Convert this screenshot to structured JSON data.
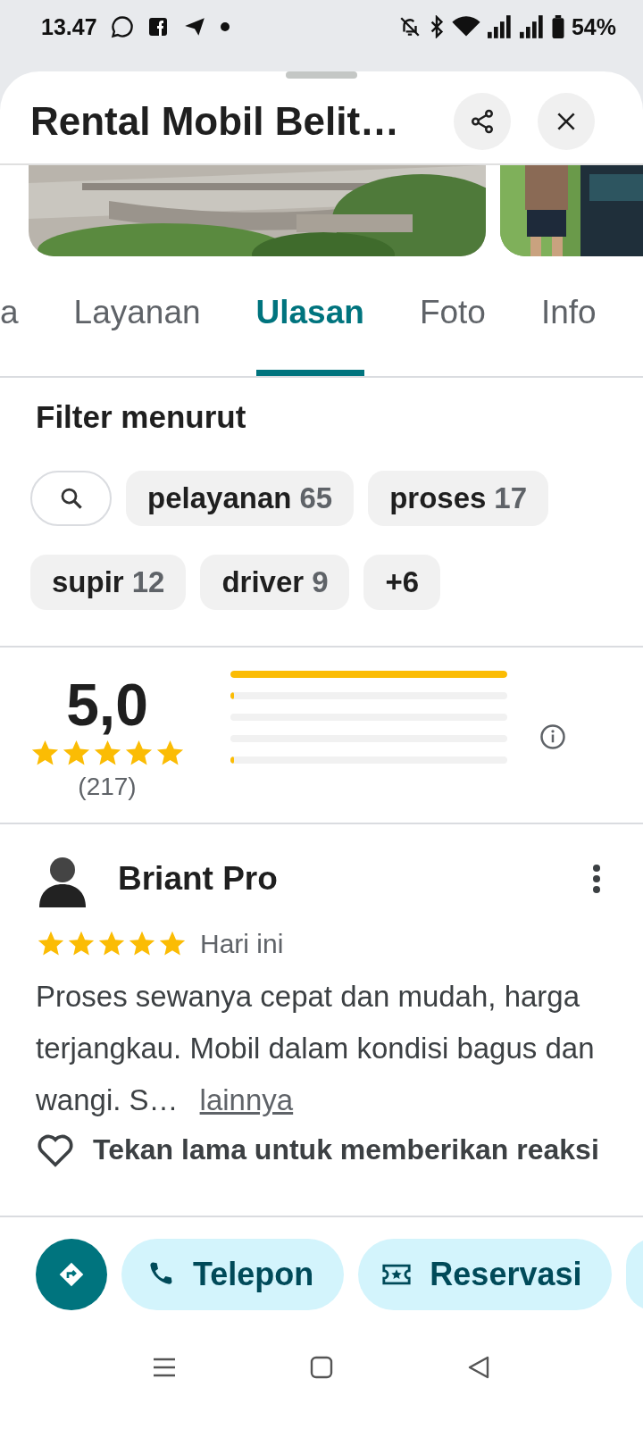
{
  "status_bar": {
    "time": "13.47",
    "battery": "54%"
  },
  "place": {
    "title": "Rental Mobil Belit…"
  },
  "tabs": [
    {
      "label": "a",
      "selected": false
    },
    {
      "label": "Layanan",
      "selected": false
    },
    {
      "label": "Ulasan",
      "selected": true
    },
    {
      "label": "Foto",
      "selected": false
    },
    {
      "label": "Info",
      "selected": false
    }
  ],
  "filter": {
    "title": "Filter menurut",
    "chips": [
      {
        "kind": "search"
      },
      {
        "kind": "topic",
        "label": "pelayanan",
        "count": "65"
      },
      {
        "kind": "topic",
        "label": "proses",
        "count": "17"
      },
      {
        "kind": "topic",
        "label": "supir",
        "count": "12"
      },
      {
        "kind": "topic",
        "label": "driver",
        "count": "9"
      },
      {
        "kind": "more",
        "label": "+6"
      }
    ]
  },
  "rating": {
    "score": "5,0",
    "stars": 5,
    "count": "(217)",
    "bars": [
      {
        "level": 1
      },
      {
        "level": 0.01
      },
      {
        "level": 0
      },
      {
        "level": 0
      },
      {
        "level": 0.01
      }
    ]
  },
  "reviews": [
    {
      "author": "Briant Pro",
      "stars": 5,
      "date": "Hari ini",
      "text": "Proses sewanya cepat dan mudah, harga terjangkau. Mobil dalam kondisi bagus dan wangi. S…",
      "more": "lainnya",
      "reaction_hint": "Tekan lama untuk memberikan reaksi"
    }
  ],
  "actions": [
    {
      "kind": "directions"
    },
    {
      "kind": "call",
      "label": "Telepon"
    },
    {
      "kind": "reserve",
      "label": "Reservasi"
    },
    {
      "kind": "cut"
    }
  ]
}
